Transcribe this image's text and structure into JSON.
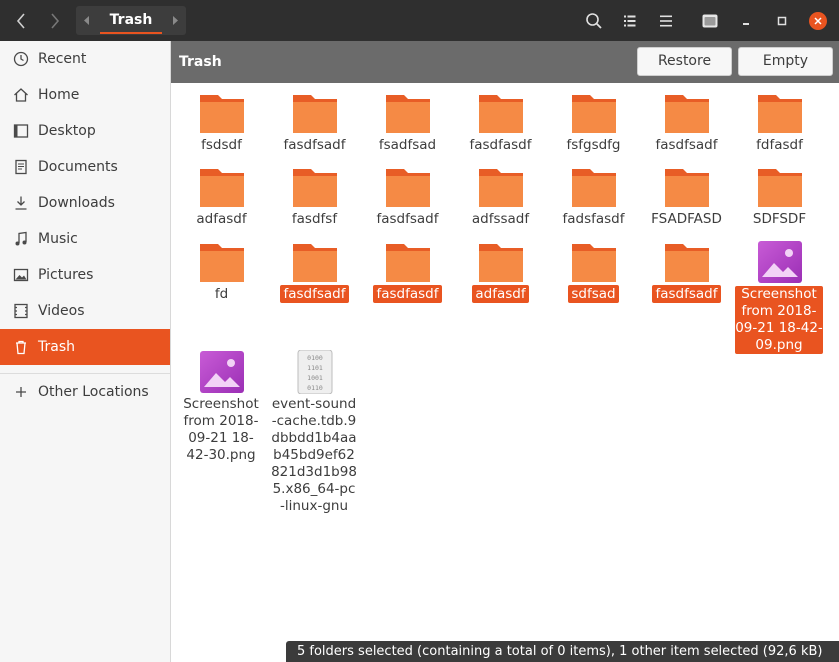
{
  "header": {
    "location": "Trash"
  },
  "sidebar": {
    "items": [
      {
        "label": "Recent",
        "icon": "clock-icon"
      },
      {
        "label": "Home",
        "icon": "home-icon"
      },
      {
        "label": "Desktop",
        "icon": "desktop-icon"
      },
      {
        "label": "Documents",
        "icon": "document-icon"
      },
      {
        "label": "Downloads",
        "icon": "download-icon"
      },
      {
        "label": "Music",
        "icon": "music-icon"
      },
      {
        "label": "Pictures",
        "icon": "picture-icon"
      },
      {
        "label": "Videos",
        "icon": "video-icon"
      },
      {
        "label": "Trash",
        "icon": "trash-icon",
        "active": true
      }
    ],
    "other_locations": "Other Locations"
  },
  "actionbar": {
    "title": "Trash",
    "restore_label": "Restore",
    "empty_label": "Empty"
  },
  "files": [
    {
      "name": "fsdsdf",
      "type": "folder",
      "selected": false
    },
    {
      "name": "fasdfsadf",
      "type": "folder",
      "selected": false
    },
    {
      "name": "fsadfsad",
      "type": "folder",
      "selected": false
    },
    {
      "name": "fasdfasdf",
      "type": "folder",
      "selected": false
    },
    {
      "name": "fsfgsdfg",
      "type": "folder",
      "selected": false
    },
    {
      "name": "fasdfsadf",
      "type": "folder",
      "selected": false
    },
    {
      "name": "fdfasdf",
      "type": "folder",
      "selected": false
    },
    {
      "name": "adfasdf",
      "type": "folder",
      "selected": false
    },
    {
      "name": "fasdfsf",
      "type": "folder",
      "selected": false
    },
    {
      "name": "fasdfsadf",
      "type": "folder",
      "selected": false
    },
    {
      "name": "adfssadf",
      "type": "folder",
      "selected": false
    },
    {
      "name": "fadsfasdf",
      "type": "folder",
      "selected": false
    },
    {
      "name": "FSADFASD",
      "type": "folder",
      "selected": false
    },
    {
      "name": "SDFSDF",
      "type": "folder",
      "selected": false
    },
    {
      "name": "fd",
      "type": "folder",
      "selected": false
    },
    {
      "name": "fasdfsadf",
      "type": "folder",
      "selected": true
    },
    {
      "name": "fasdfasdf",
      "type": "folder",
      "selected": true
    },
    {
      "name": "adfasdf",
      "type": "folder",
      "selected": true
    },
    {
      "name": "sdfsad",
      "type": "folder",
      "selected": true
    },
    {
      "name": "fasdfsadf",
      "type": "folder",
      "selected": true
    },
    {
      "name": "Screenshot from 2018-09-21 18-42-09.png",
      "type": "image",
      "selected": true
    },
    {
      "name": "Screenshot from 2018-09-21 18-42-30.png",
      "type": "image",
      "selected": false
    },
    {
      "name": "event-sound-cache.tdb.9dbbdd1b4aab45bd9ef62821d3d1b985.x86_64-pc-linux-gnu",
      "type": "binary",
      "selected": false
    }
  ],
  "status": "5 folders selected (containing a total of 0 items), 1 other item selected (92,6 kB)",
  "colors": {
    "accent": "#e95420",
    "folder": "#f07c3a",
    "headerbar": "#2f2f2f"
  }
}
